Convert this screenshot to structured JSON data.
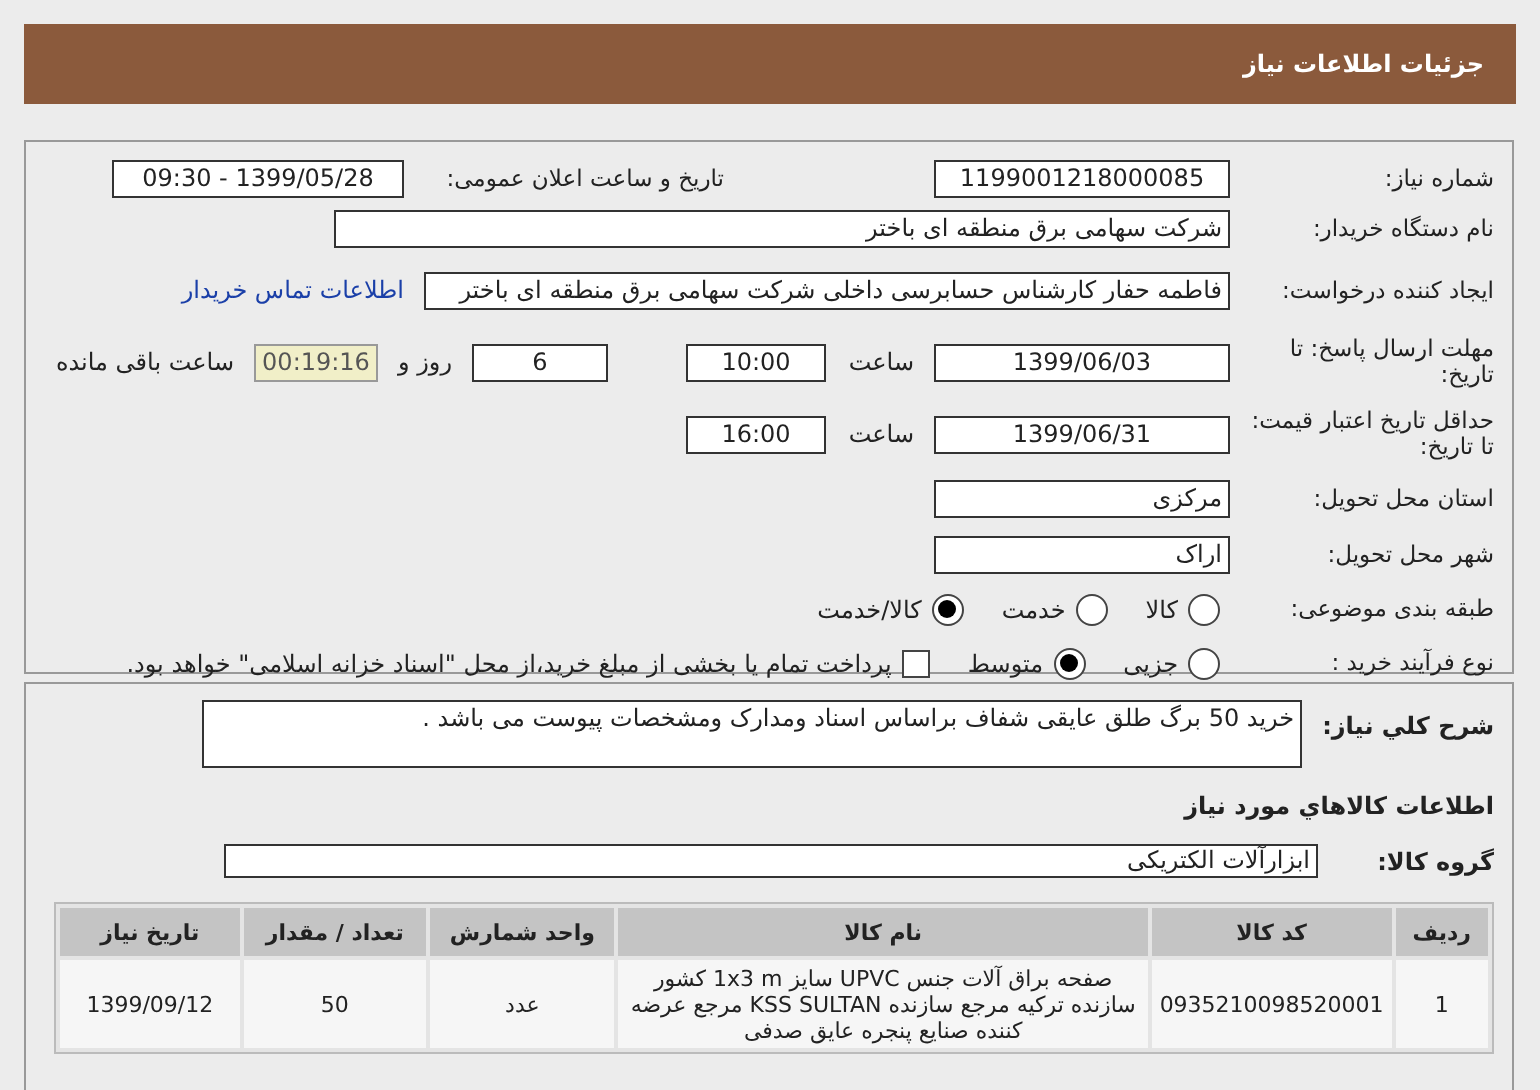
{
  "title": "جزئیات اطلاعات نیاز",
  "need_number": {
    "label": "شماره نیاز:",
    "value": "1199001218000085"
  },
  "announce": {
    "label": "تاریخ و ساعت اعلان عمومی:",
    "value": "1399/05/28 - 09:30"
  },
  "buyer": {
    "label": "نام دستگاه خریدار:",
    "value": "شرکت سهامی برق منطقه ای باختر"
  },
  "requester": {
    "label": "ایجاد کننده درخواست:",
    "value": "فاطمه حفار کارشناس حسابرسی داخلی شرکت سهامی برق منطقه ای باختر",
    "link": "اطلاعات تماس خریدار"
  },
  "deadline": {
    "label": "مهلت ارسال پاسخ: تا تاریخ:",
    "date": "1399/06/03",
    "time_label": "ساعت",
    "time": "10:00",
    "days": "6",
    "days_label": "روز و",
    "remaining": "00:19:16",
    "remaining_label": "ساعت باقی مانده"
  },
  "validity": {
    "label": "حداقل تاریخ اعتبار قیمت: تا تاریخ:",
    "date": "1399/06/31",
    "time_label": "ساعت",
    "time": "16:00"
  },
  "province": {
    "label": "استان محل تحویل:",
    "value": "مرکزی"
  },
  "city": {
    "label": "شهر محل تحویل:",
    "value": "اراک"
  },
  "category": {
    "label": "طبقه بندی موضوعی:",
    "options": [
      {
        "label": "کالا",
        "selected": false
      },
      {
        "label": "خدمت",
        "selected": false
      },
      {
        "label": "کالا/خدمت",
        "selected": true
      }
    ]
  },
  "process": {
    "label": "نوع فرآیند خرید :",
    "options": [
      {
        "label": "جزیی",
        "selected": false
      },
      {
        "label": "متوسط",
        "selected": true
      }
    ],
    "treasury": {
      "label": "پرداخت تمام یا بخشی از مبلغ خرید،از محل \"اسناد خزانه اسلامی\" خواهد بود.",
      "checked": false
    }
  },
  "description": {
    "label": "شرح کلي نیاز:",
    "value": "خرید 50 برگ طلق عایقی شفاف براساس اسناد ومدارک ومشخصات پیوست می باشد ."
  },
  "items_title": "اطلاعات کالاهاي مورد نیاز",
  "goods_group": {
    "label": "گروه کالا:",
    "value": "ابزارآلات الکتریکی"
  },
  "table": {
    "columns": [
      "ردیف",
      "کد کالا",
      "نام کالا",
      "واحد شمارش",
      "تعداد / مقدار",
      "تاریخ نیاز"
    ],
    "rows": [
      [
        "1",
        "0935210098520001",
        "صفحه براق آلات جنس UPVC سایز 1x3 m کشور سازنده ترکیه مرجع سازنده KSS SULTAN مرجع عرضه کننده صنایع پنجره عایق صدفی",
        "عدد",
        "50",
        "1399/09/12"
      ]
    ]
  }
}
